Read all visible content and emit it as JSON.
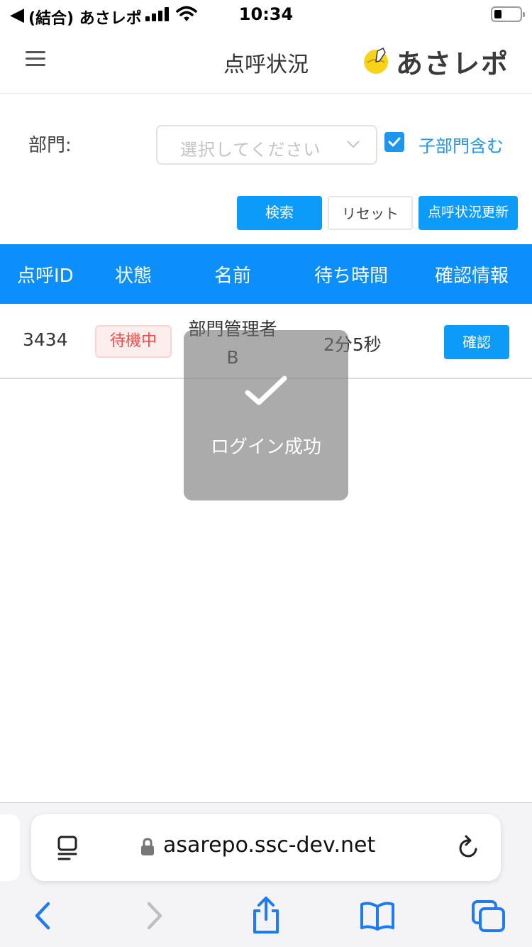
{
  "status_bar": {
    "back_arrow": "◀",
    "carrier": "(結合) あさレポ",
    "time": "10:34",
    "icons": [
      "signal-icon",
      "wifi-icon",
      "battery-icon"
    ]
  },
  "header": {
    "title": "点呼状況",
    "logo_text": "あさレポ",
    "icons": [
      "menu-icon",
      "logo-icon"
    ]
  },
  "filter": {
    "dept_label": "部門:",
    "dept_placeholder": "選択してください",
    "include_children_label": "子部門含む",
    "include_children_checked": true
  },
  "actions": {
    "search_label": "検索",
    "reset_label": "リセット",
    "update_label": "点呼状況更新"
  },
  "table": {
    "columns": [
      "点呼ID",
      "状態",
      "名前",
      "待ち時間",
      "確認情報"
    ],
    "rows": [
      {
        "id": "3434",
        "status": "待機中",
        "name_line1": "部門管理者",
        "name_line2": "B",
        "wait": "2分5秒",
        "action": "確認"
      }
    ]
  },
  "toast": {
    "text": "ログイン成功",
    "icon": "check-icon"
  },
  "browser": {
    "url": "asarepo.ssc-dev.net",
    "icons": [
      "reader-icon",
      "lock-icon",
      "reload-icon",
      "back-icon",
      "forward-icon",
      "share-icon",
      "bookmarks-icon",
      "tabs-icon"
    ]
  },
  "colors": {
    "primary": "#0c9bf9",
    "table_header": "#0c8ffa",
    "status_waiting": "#ef4c4c"
  }
}
